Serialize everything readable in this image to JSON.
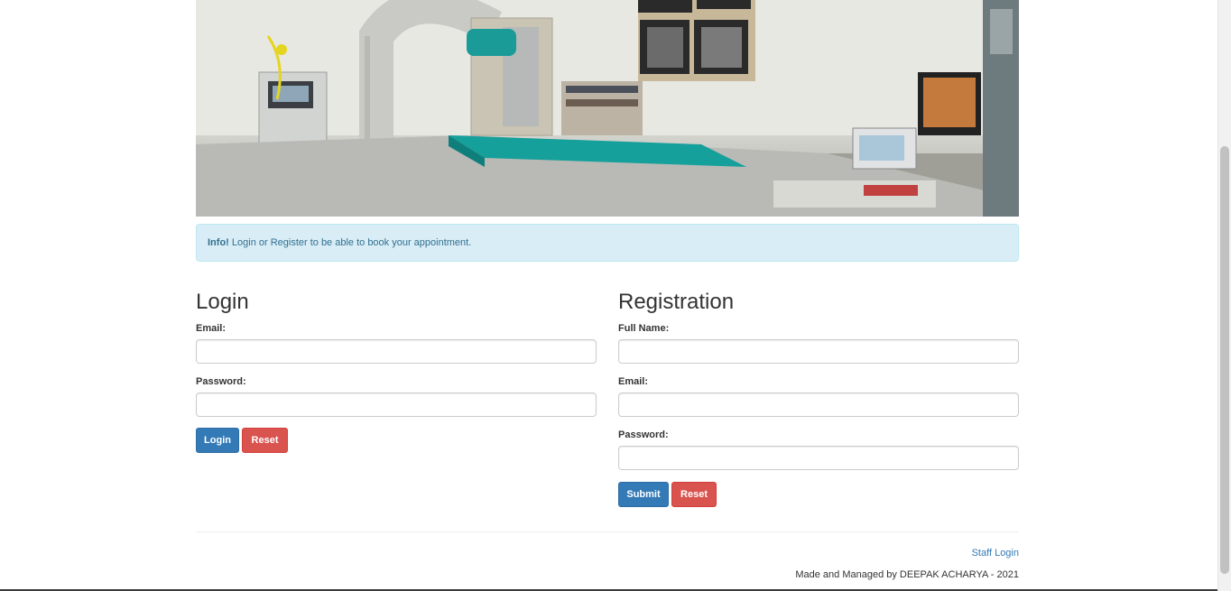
{
  "hero": {
    "alt": "Hospital operating room"
  },
  "alert": {
    "strong": "Info!",
    "message": "Login or Register to be able to book your appointment."
  },
  "login": {
    "title": "Login",
    "email_label": "Email:",
    "email_value": "",
    "password_label": "Password:",
    "password_value": "",
    "submit_label": "Login",
    "reset_label": "Reset"
  },
  "registration": {
    "title": "Registration",
    "fullname_label": "Full Name:",
    "fullname_value": "",
    "email_label": "Email:",
    "email_value": "",
    "password_label": "Password:",
    "password_value": "",
    "submit_label": "Submit",
    "reset_label": "Reset"
  },
  "footer": {
    "staff_link": "Staff Login",
    "credit": "Made and Managed by DEEPAK ACHARYA - 2021"
  },
  "colors": {
    "primary": "#337ab7",
    "danger": "#d9534f",
    "alert_bg": "#d9edf7",
    "alert_text": "#31708f"
  }
}
